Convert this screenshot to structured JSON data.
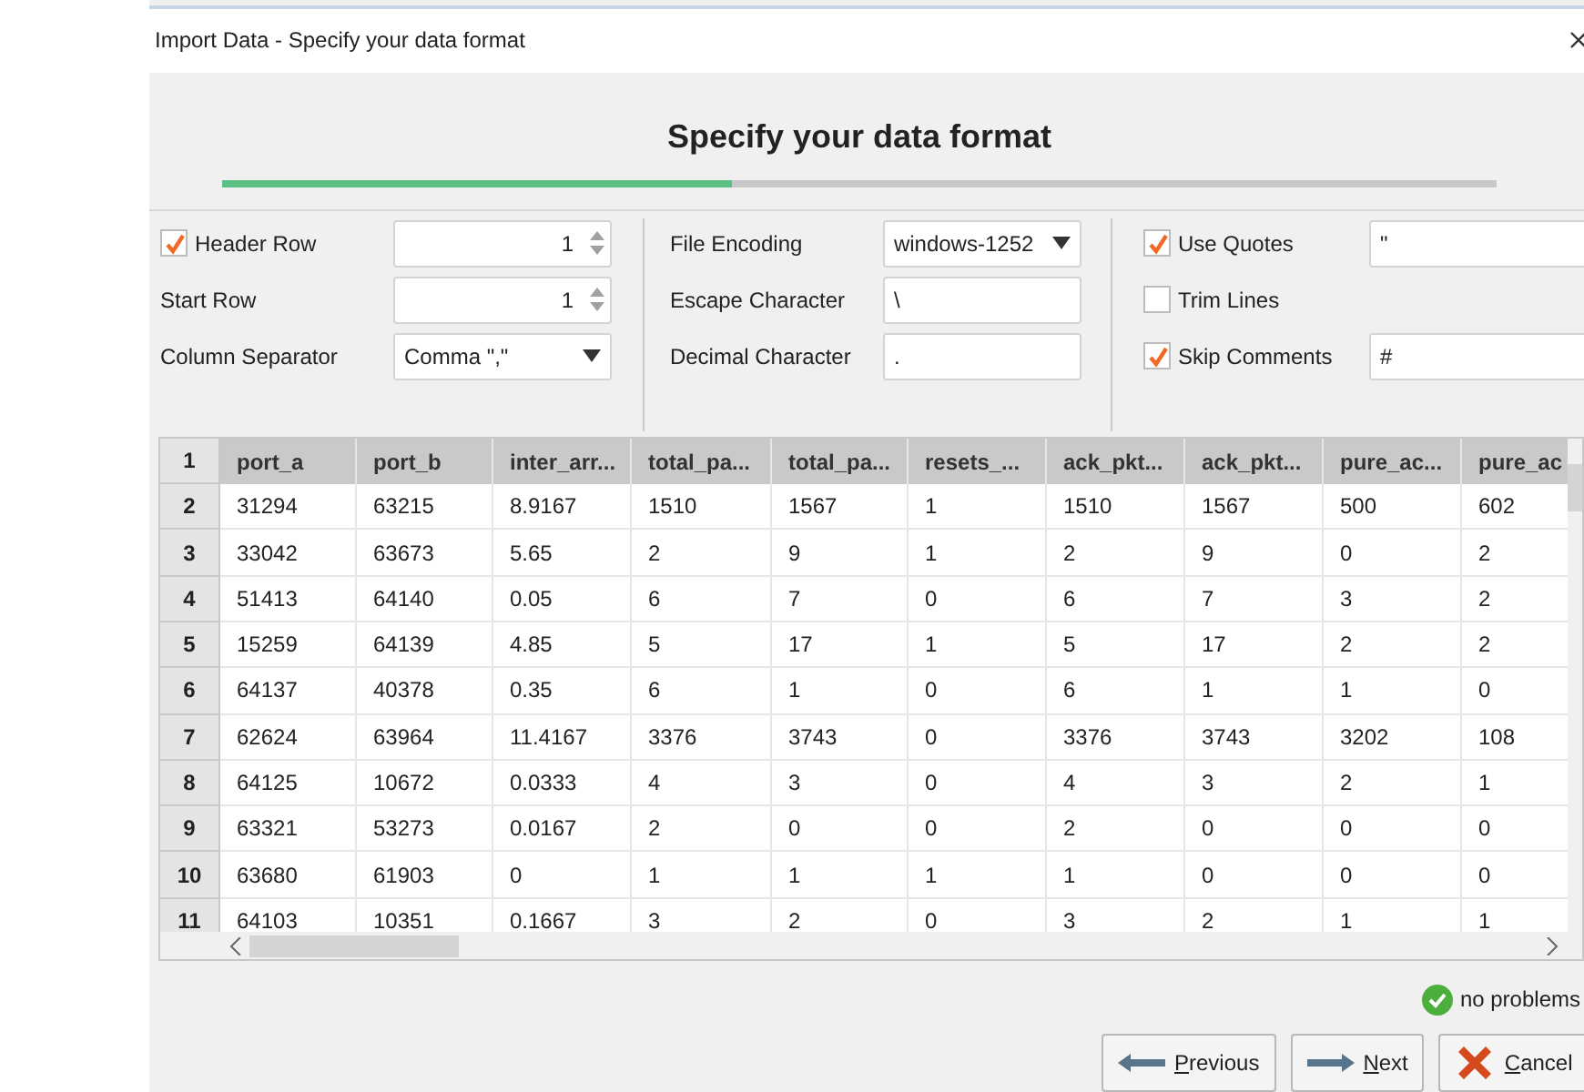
{
  "window": {
    "title": "Import Data - Specify your data format"
  },
  "heading": "Specify your data format",
  "progress": {
    "level": 0.4
  },
  "options": [
    {
      "kind": "spinner",
      "label": "Header Row",
      "checked": true,
      "value": "1"
    },
    {
      "kind": "dropdown",
      "label": "File Encoding",
      "value": "windows-1252"
    },
    {
      "kind": "text",
      "label": "Use Quotes",
      "checked": true,
      "value": "\""
    },
    {
      "kind": "spinner",
      "label": "Start Row",
      "value": "1"
    },
    {
      "kind": "text",
      "label": "Escape Character",
      "value": "\\"
    },
    {
      "kind": "none",
      "label": "Trim Lines",
      "checked": false
    },
    {
      "kind": "dropdown",
      "label": "Column Separator",
      "value": "Comma \",\""
    },
    {
      "kind": "text",
      "label": "Decimal Character",
      "value": "."
    },
    {
      "kind": "text",
      "label": "Skip Comments",
      "checked": true,
      "value": "#"
    }
  ],
  "table": {
    "header_number": "1",
    "columns": [
      "port_a",
      "port_b",
      "inter_arr...",
      "total_pa...",
      "total_pa...",
      "resets_...",
      "ack_pkt...",
      "ack_pkt...",
      "pure_ac...",
      "pure_ac"
    ],
    "rows": [
      {
        "number": "2",
        "cells": [
          "31294",
          "63215",
          "8.9167",
          "1510",
          "1567",
          "1",
          "1510",
          "1567",
          "500",
          "602"
        ]
      },
      {
        "number": "3",
        "cells": [
          "33042",
          "63673",
          "5.65",
          "2",
          "9",
          "1",
          "2",
          "9",
          "0",
          "2"
        ]
      },
      {
        "number": "4",
        "cells": [
          "51413",
          "64140",
          "0.05",
          "6",
          "7",
          "0",
          "6",
          "7",
          "3",
          "2"
        ]
      },
      {
        "number": "5",
        "cells": [
          "15259",
          "64139",
          "4.85",
          "5",
          "17",
          "1",
          "5",
          "17",
          "2",
          "2"
        ]
      },
      {
        "number": "6",
        "cells": [
          "64137",
          "40378",
          "0.35",
          "6",
          "1",
          "0",
          "6",
          "1",
          "1",
          "0"
        ]
      },
      {
        "number": "7",
        "cells": [
          "62624",
          "63964",
          "11.4167",
          "3376",
          "3743",
          "0",
          "3376",
          "3743",
          "3202",
          "108"
        ]
      },
      {
        "number": "8",
        "cells": [
          "64125",
          "10672",
          "0.0333",
          "4",
          "3",
          "0",
          "4",
          "3",
          "2",
          "1"
        ]
      },
      {
        "number": "9",
        "cells": [
          "63321",
          "53273",
          "0.0167",
          "2",
          "0",
          "0",
          "2",
          "0",
          "0",
          "0"
        ]
      },
      {
        "number": "10",
        "cells": [
          "63680",
          "61903",
          "0",
          "1",
          "1",
          "1",
          "1",
          "0",
          "0",
          "0"
        ]
      },
      {
        "number": "11",
        "cells": [
          "64103",
          "10351",
          "0.1667",
          "3",
          "2",
          "0",
          "3",
          "2",
          "1",
          "1"
        ]
      }
    ]
  },
  "status": {
    "kind": "ok",
    "text": "no problems"
  },
  "buttons": [
    {
      "kind": "previous",
      "mnemonic": "P",
      "rest": "revious"
    },
    {
      "kind": "next",
      "mnemonic": "N",
      "rest": "ext"
    },
    {
      "kind": "cancel",
      "mnemonic": "C",
      "rest": "ancel"
    }
  ]
}
